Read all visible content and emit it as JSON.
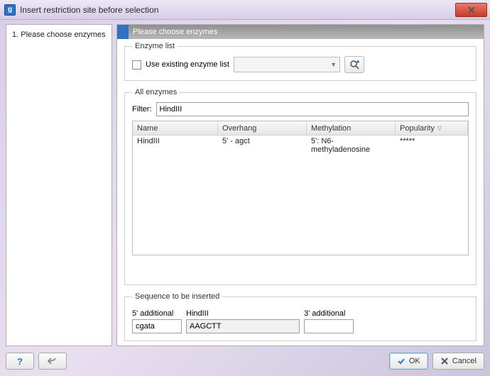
{
  "titlebar": {
    "title": "Insert restriction site before selection"
  },
  "steps": {
    "items": [
      {
        "label": "1.  Please choose enzymes"
      }
    ]
  },
  "content": {
    "header": "Please choose enzymes",
    "enzyme_list": {
      "legend": "Enzyme list",
      "use_existing_label": "Use existing enzyme list"
    },
    "all_enzymes": {
      "legend": "All enzymes",
      "filter_label": "Filter:",
      "filter_value": "HindIII",
      "columns": {
        "name": "Name",
        "overhang": "Overhang",
        "methylation": "Methylation",
        "popularity": "Popularity"
      },
      "rows": [
        {
          "name": "HindIII",
          "overhang": "5' - agct",
          "methylation": "5': N6-methyladenosine",
          "popularity": "*****"
        }
      ]
    },
    "sequence": {
      "legend": "Sequence to be inserted",
      "five_label": "5' additional",
      "enzyme_label": "HindIII",
      "three_label": "3' additional",
      "five_value": "cgata",
      "enzyme_value": "AAGCTT",
      "three_value": ""
    }
  },
  "footer": {
    "ok": "OK",
    "cancel": "Cancel"
  }
}
